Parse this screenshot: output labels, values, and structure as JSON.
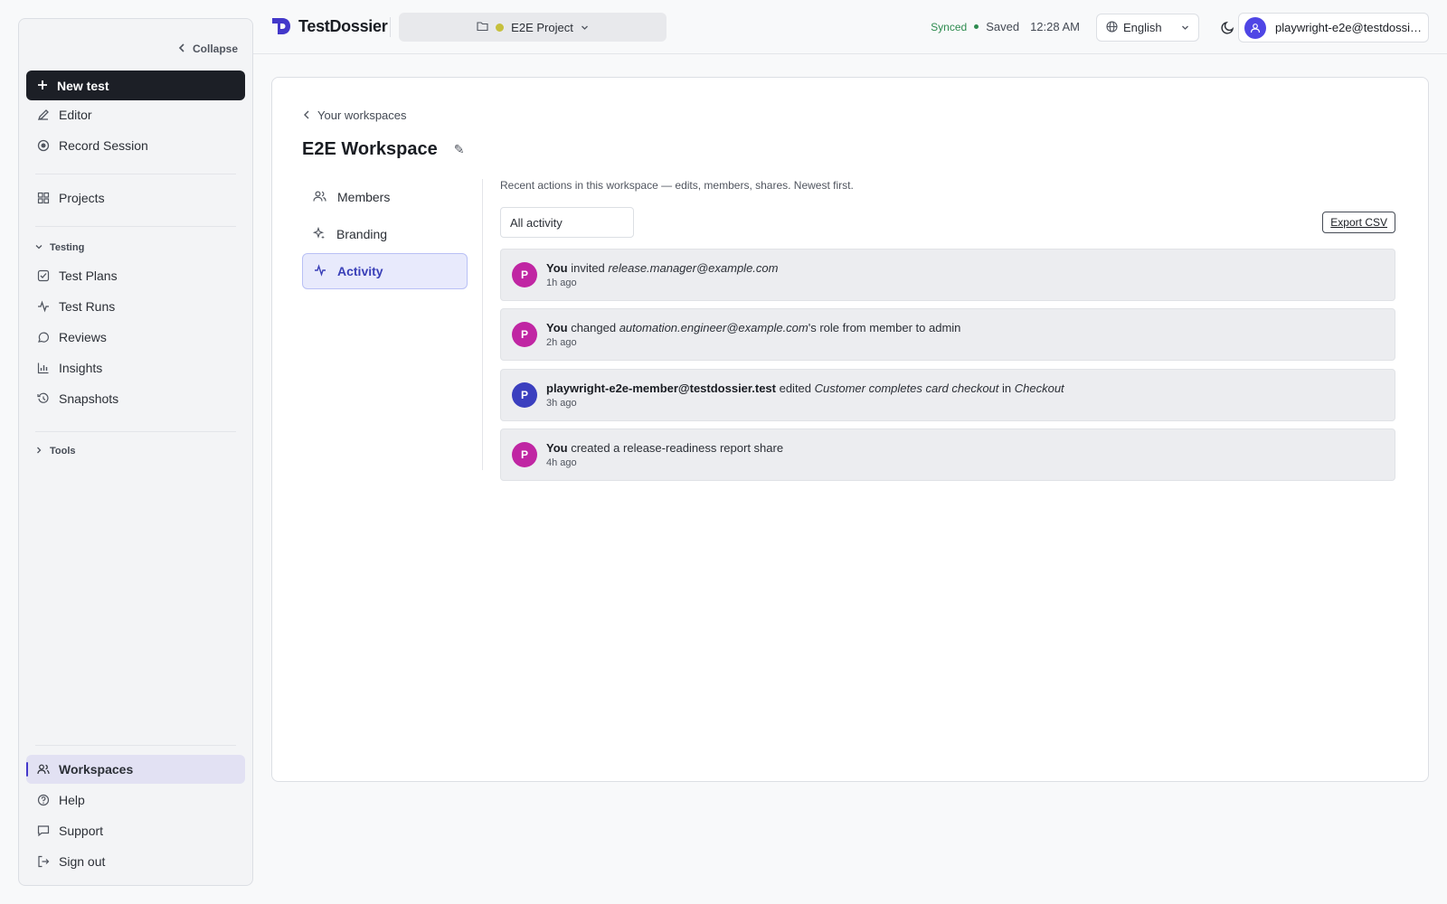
{
  "sidebar": {
    "collapse_label": "Collapse",
    "new_test_label": "New test",
    "editor_label": "Editor",
    "record_label": "Record Session",
    "projects_label": "Projects",
    "testing_section": "Testing",
    "test_plans_label": "Test Plans",
    "test_runs_label": "Test Runs",
    "reviews_label": "Reviews",
    "insights_label": "Insights",
    "snapshots_label": "Snapshots",
    "tools_section": "Tools",
    "workspaces_label": "Workspaces",
    "help_label": "Help",
    "support_label": "Support",
    "signout_label": "Sign out"
  },
  "topbar": {
    "brand": "TestDossier",
    "project": "E2E Project",
    "synced": "Synced",
    "saved": "Saved",
    "time": "12:28 AM",
    "language": "English",
    "user": "playwright-e2e@testdossier.test"
  },
  "main": {
    "back_label": "Your workspaces",
    "workspace_title": "E2E Workspace",
    "edit_glyph": "✎",
    "tabs": {
      "members": "Members",
      "branding": "Branding",
      "activity": "Activity"
    },
    "description": "Recent actions in this workspace — edits, members, shares. Newest first.",
    "filter_value": "All activity",
    "export_label": "Export CSV",
    "activities": [
      {
        "initial": "P",
        "avatar_color": "#c026a3",
        "actor": "You",
        "verb": " invited ",
        "object": "release.manager@example.com",
        "rest": "",
        "time": "1h ago"
      },
      {
        "initial": "P",
        "avatar_color": "#c026a3",
        "actor": "You",
        "verb": " changed ",
        "object": "automation.engineer@example.com",
        "rest": "'s role from member to admin",
        "time": "2h ago"
      },
      {
        "initial": "P",
        "avatar_color": "#3b3fbf",
        "actor": "playwright-e2e-member@testdossier.test",
        "verb": " edited ",
        "object": "Customer completes card checkout",
        "rest": " in ",
        "object2": "Checkout",
        "time": "3h ago"
      },
      {
        "initial": "P",
        "avatar_color": "#c026a3",
        "actor": "You",
        "verb": " created a release-readiness report share",
        "object": "",
        "rest": "",
        "time": "4h ago"
      }
    ]
  },
  "colors": {
    "accent": "#4338ca",
    "synced": "#2e8b4f"
  }
}
